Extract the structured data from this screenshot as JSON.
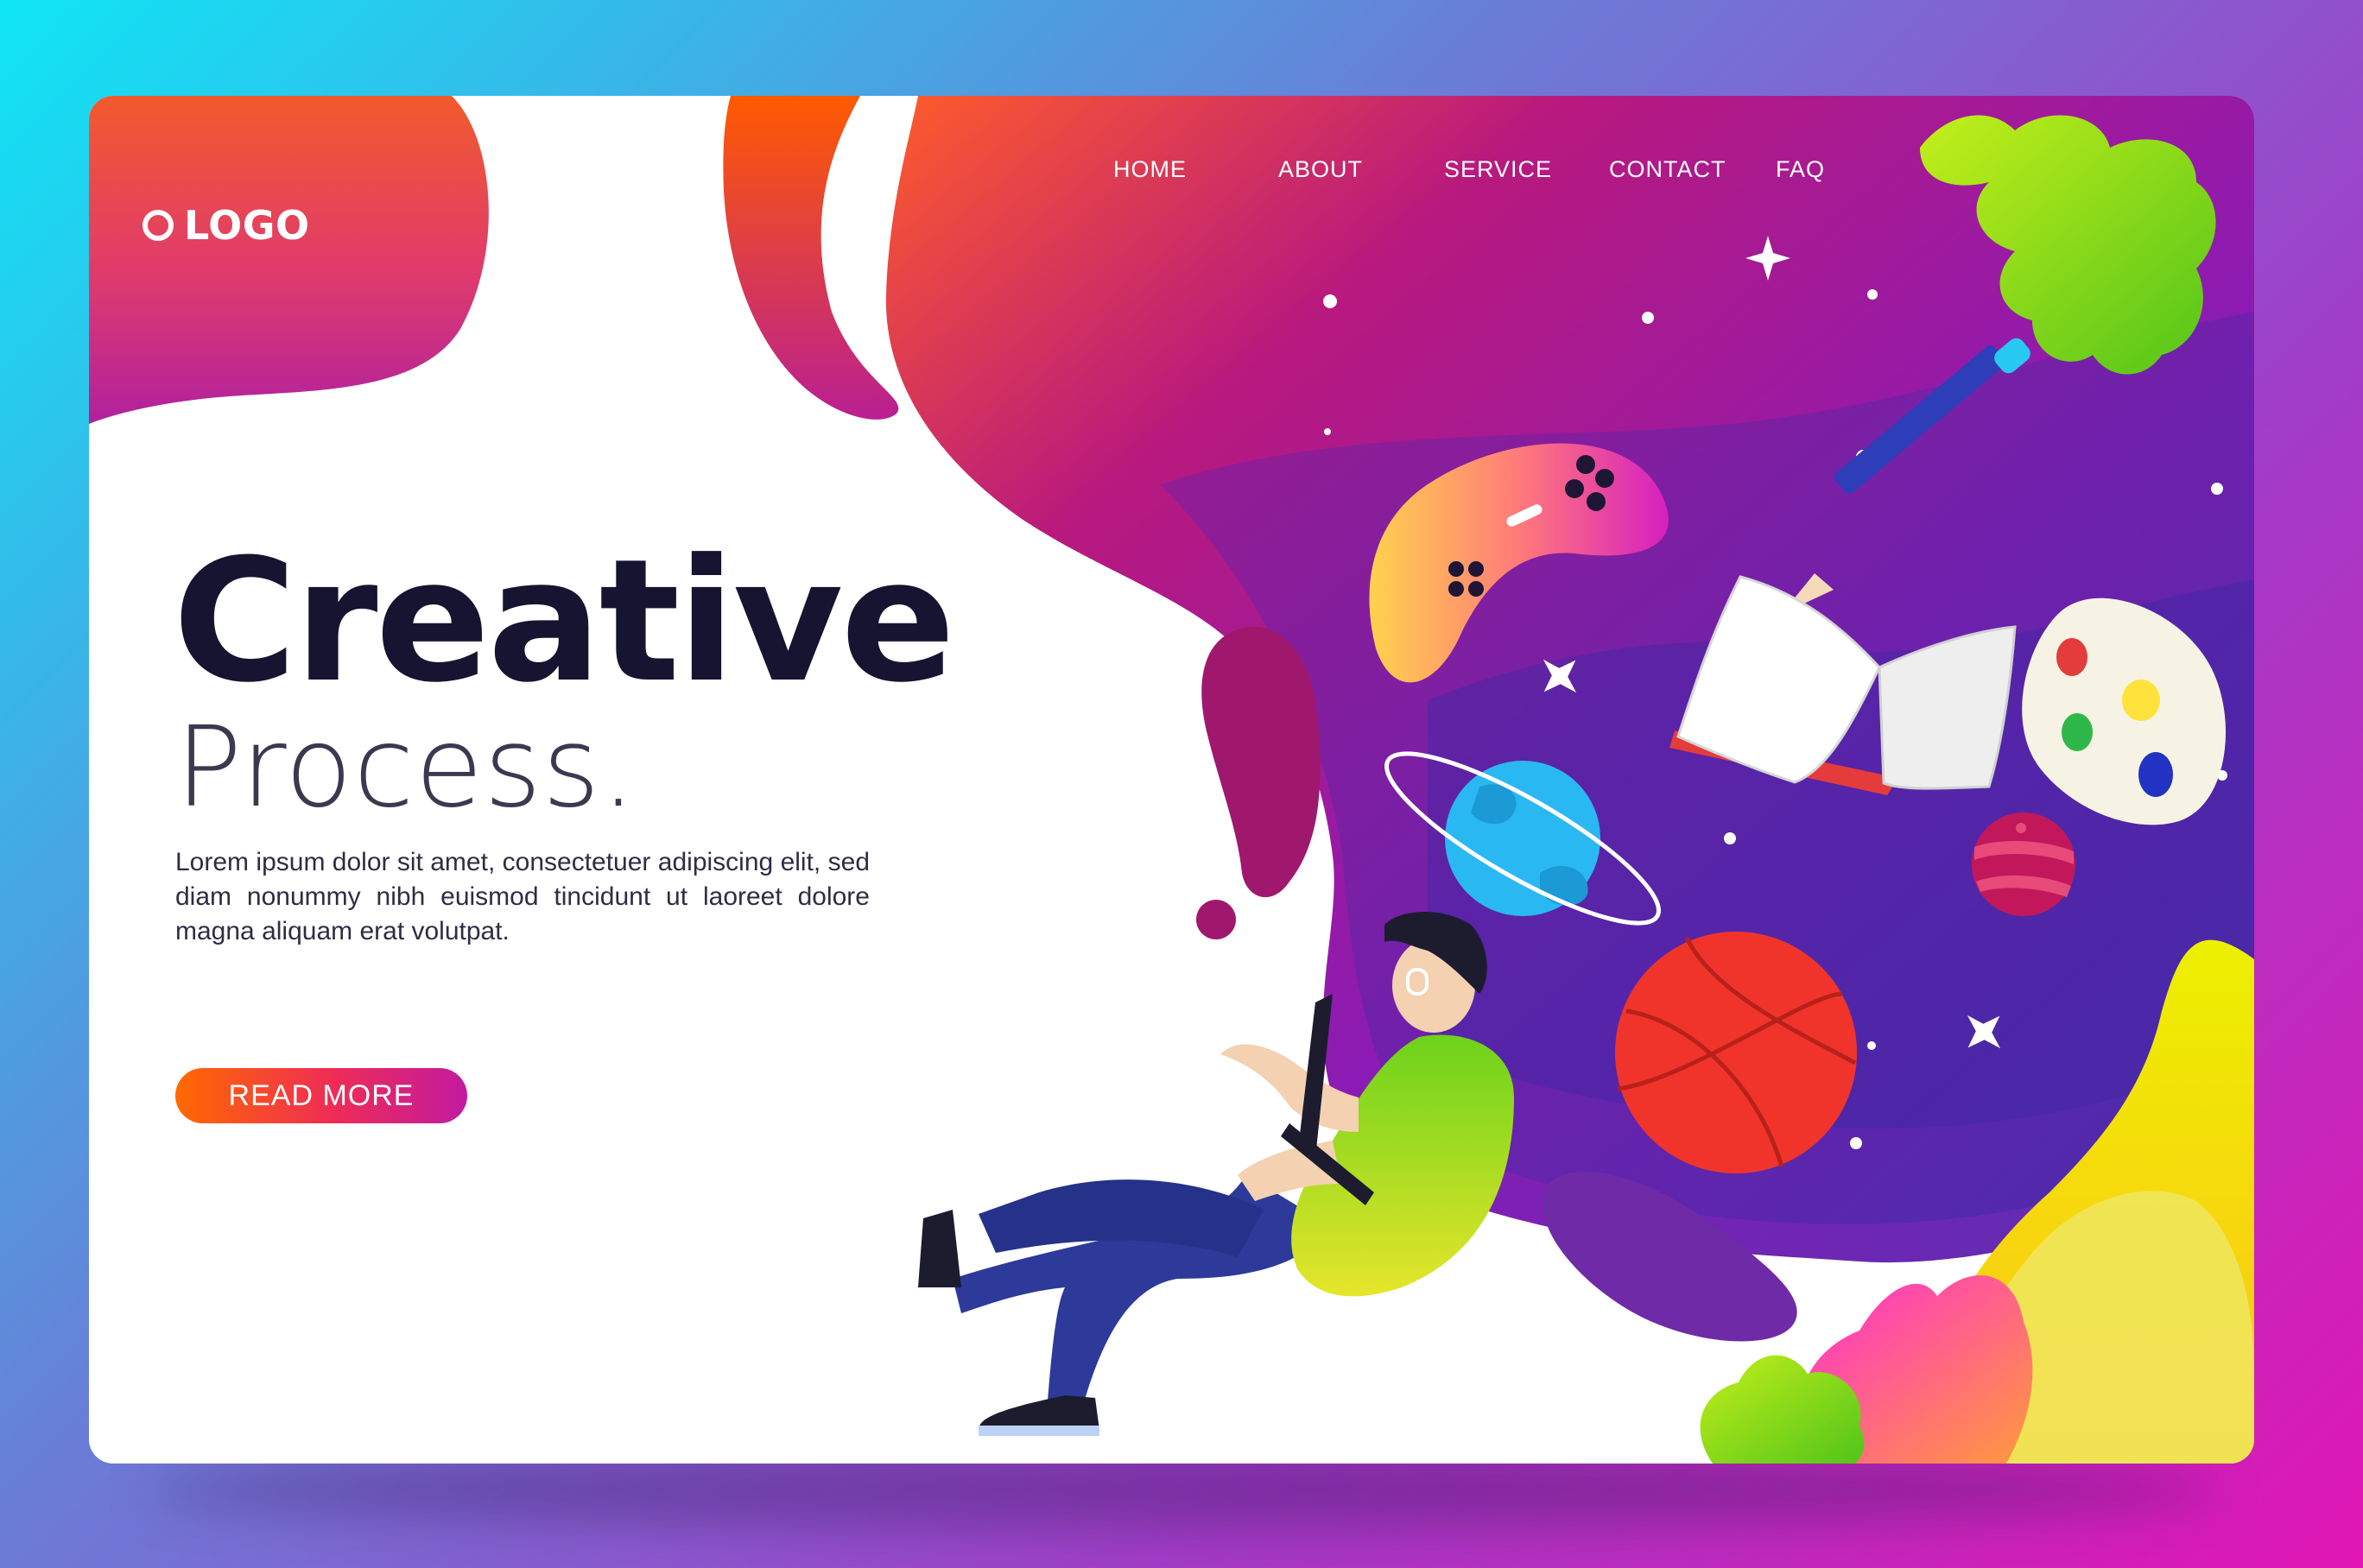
{
  "header": {
    "logo_text": "LOGO",
    "nav": [
      "HOME",
      "ABOUT",
      "SERVICE",
      "CONTACT",
      "FAQ"
    ]
  },
  "hero": {
    "title": "Creative",
    "subtitle": "Process.",
    "description": "Lorem ipsum dolor sit amet, consectetuer adipiscing elit, sed diam nonummy nibh euismod tincidunt ut laoreet dolore magna aliquam erat volutpat.",
    "cta_label": "READ MORE"
  },
  "colors": {
    "background_start": "#0fe6f5",
    "background_end": "#e016b4",
    "accent_orange": "#ff6a00",
    "accent_magenta": "#c21aa2",
    "accent_purple": "#6a2bb0",
    "text_dark": "#161430"
  },
  "icons": [
    "logo-ring-icon",
    "game-controller-icon",
    "pencil-icon",
    "open-book-icon",
    "paint-palette-icon",
    "ringed-planet-icon",
    "planet-icon",
    "basketball-icon",
    "sparkle-icon",
    "leaf-icon"
  ]
}
